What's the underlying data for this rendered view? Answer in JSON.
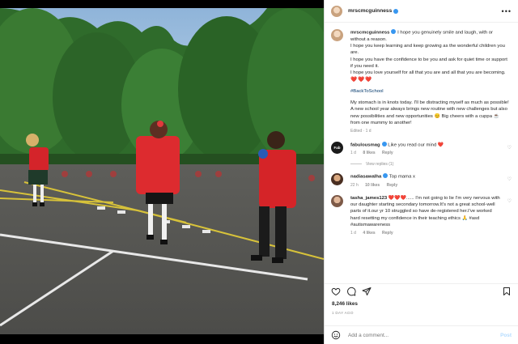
{
  "post": {
    "username": "mrscmcguinness",
    "caption_lines": [
      "I hope you genuinely smile and laugh, with or without a reason.",
      "I hope you keep learning and keep growing as the wonderful children you are.",
      "I hope you have the confidence to be you and ask for quiet time or support if you need it.",
      "I hope you love yourself for all that you are and all that you are becoming."
    ],
    "hearts": "❤️❤️❤️",
    "hashtag": "#BackToSchool",
    "caption_lines_2": [
      "My stomach is in knots today. I'll be distracting myself as much as possible!",
      "A new school year always brings new routine with new challenges but also new possibilities and new opportunities 😊 Big cheers with a cuppa ☕ from one mummy to another!"
    ],
    "caption_meta": "Edited · 1 d",
    "likes": "8,246 likes",
    "date": "1 DAY AGO"
  },
  "comments": [
    {
      "username": "fabulousmag",
      "text": "Like you read our mind ❤️",
      "time": "1 d",
      "likes": "8 likes",
      "reply": "Reply",
      "view_replies": "View replies (1)",
      "avatar_color": "#1a1a1a",
      "avatar_text": "Fab"
    },
    {
      "username": "nadiasawalha",
      "text": "Top mama x",
      "time": "22 h",
      "likes": "10 likes",
      "reply": "Reply",
      "avatar_color": "#6b4a33"
    },
    {
      "username": "tasha_james123",
      "text": "❤️❤️❤️...... I'm not going to lie I'm very nervous with our daughter starting secondary tomorrow.It's not a great school-well parts of it.our yr 10 struggled so have de-registered her.I've worked hard resetting my confidence in their teaching ethics 🙏 #asd #autismawareness",
      "time": "1 d",
      "likes": "4 likes",
      "reply": "Reply",
      "avatar_color": "#7d5a48"
    }
  ],
  "add_comment": {
    "placeholder": "Add a comment...",
    "post_label": "Post"
  },
  "icons": {
    "like": "heart-icon",
    "comment": "comment-icon",
    "share": "paper-plane-icon",
    "save": "bookmark-icon",
    "emoji": "smiley-icon",
    "more": "more-options-icon"
  },
  "colors": {
    "verified": "#3897f0",
    "heart": "#ed4956",
    "post_button": "#b3dbff",
    "hashtag": "#00376b"
  }
}
